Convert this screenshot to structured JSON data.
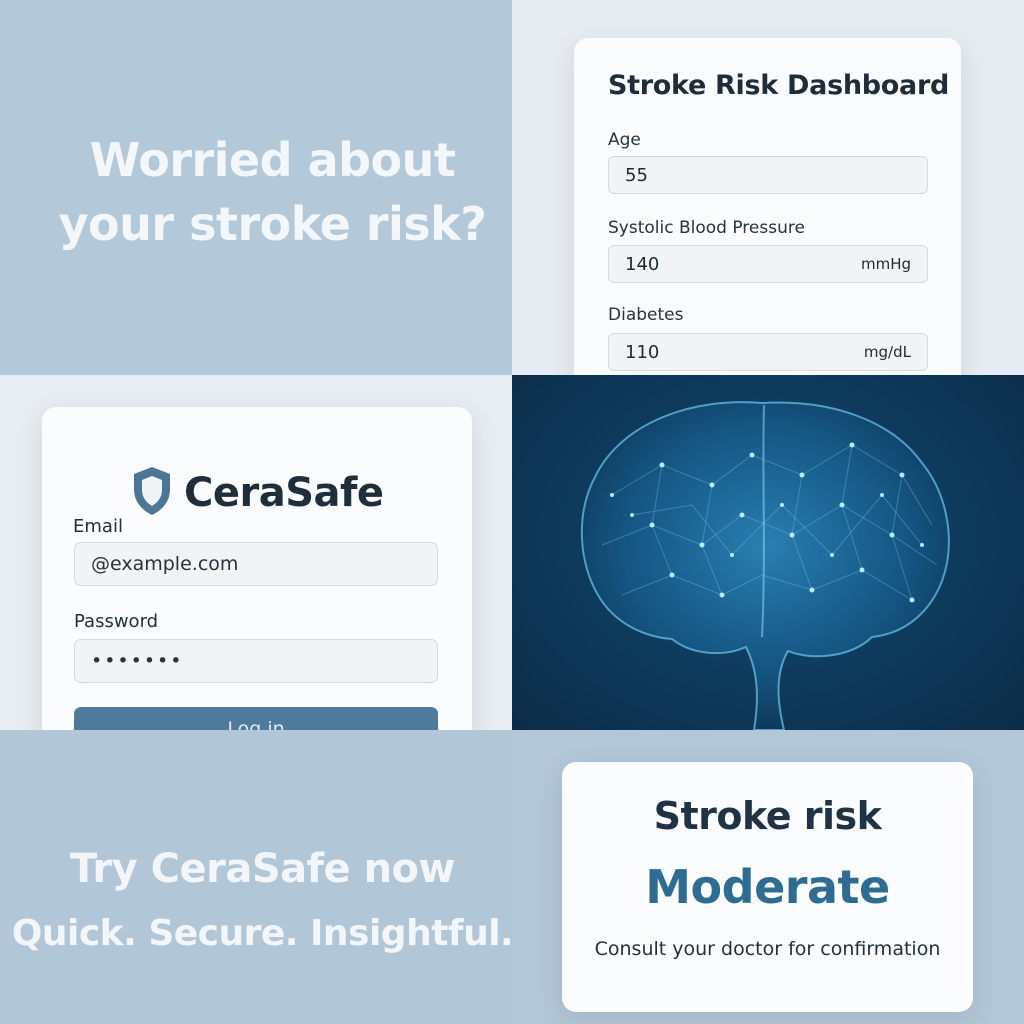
{
  "hero": {
    "line1": "Worried about",
    "line2": "your stroke risk?"
  },
  "dashboard": {
    "title": "Stroke Risk Dashboard",
    "fields": [
      {
        "label": "Age",
        "value": "55",
        "unit": ""
      },
      {
        "label": "Systolic Blood Pressure",
        "value": "140",
        "unit": "mmHg"
      },
      {
        "label": "Diabetes",
        "value": "110",
        "unit": "mg/dL"
      }
    ]
  },
  "login": {
    "brand": "CeraSafe",
    "email_label": "Email",
    "email_value": "@example.com",
    "password_label": "Password",
    "password_value": "•••••••",
    "login_button": "Log in"
  },
  "cta": {
    "line1": "Try CeraSafe now",
    "line2": "Quick. Secure. Insightful."
  },
  "result": {
    "title": "Stroke risk",
    "level": "Moderate",
    "note": "Consult your doctor for confirmation"
  },
  "colors": {
    "accent": "#2f6c92",
    "button": "#4e7b9b",
    "brain_glow": "#4fb6ea"
  },
  "icons": {
    "brand_logo": "shield-icon",
    "brain_image": "brain-illustration"
  }
}
